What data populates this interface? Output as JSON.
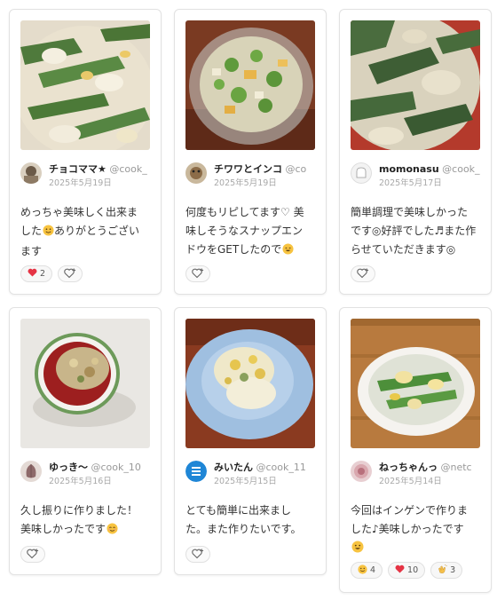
{
  "cards": [
    {
      "user_name": "チョコママ★",
      "user_handle": "@cook_",
      "date": "2025年5月19日",
      "comment_line1": "めっちゃ美味しく出来ま",
      "comment_line2": "した",
      "comment_line2_after": "ありがとうござい",
      "comment_line3": "ます",
      "reactions": [
        {
          "emoji": "heart",
          "count": "2"
        }
      ]
    },
    {
      "user_name": "チワワとインコ",
      "user_handle": "@co",
      "date": "2025年5月19日",
      "comment_line1": "何度もリピしてます♡ 美",
      "comment_line2": "味しそうなスナップエン",
      "comment_line3": "ドウをGETしたので",
      "reactions": []
    },
    {
      "user_name": "momonasu",
      "user_handle": "@cook_",
      "date": "2025年5月17日",
      "comment_line1": "簡単調理で美味しかった",
      "comment_line2": "です◎好評でした♬また作",
      "comment_line3": "らせていただきます◎",
      "reactions": []
    },
    {
      "user_name": "ゆっき〜",
      "user_handle": "@cook_10",
      "date": "2025年5月16日",
      "comment_line1": "久し振りに作りました！",
      "comment_line2": "美味しかったです",
      "reactions": []
    },
    {
      "user_name": "みいたん",
      "user_handle": "@cook_11",
      "date": "2025年5月15日",
      "comment_line1": "とても簡単に出来まし",
      "comment_line2": "た。また作りたいです。",
      "reactions": []
    },
    {
      "user_name": "ねっちゃんっ",
      "user_handle": "@netc",
      "date": "2025年5月14日",
      "comment_line1": "今回はインゲンで作りま",
      "comment_line2": "した♪美味しかったです",
      "reactions": [
        {
          "emoji": "smile",
          "count": "4"
        },
        {
          "emoji": "heart",
          "count": "10"
        },
        {
          "emoji": "clap",
          "count": "3"
        }
      ]
    }
  ],
  "icons": {
    "add_reaction": "heart-plus-icon",
    "heart": "heart-icon",
    "smile": "smiling-face-icon",
    "clap": "clapping-hands-icon"
  },
  "colors": {
    "heart": "#e53344",
    "emoji_yellow": "#f7c340",
    "handle_gray": "#999999",
    "date_gray": "#a8a8a8",
    "card_border": "#e2e2e2"
  }
}
